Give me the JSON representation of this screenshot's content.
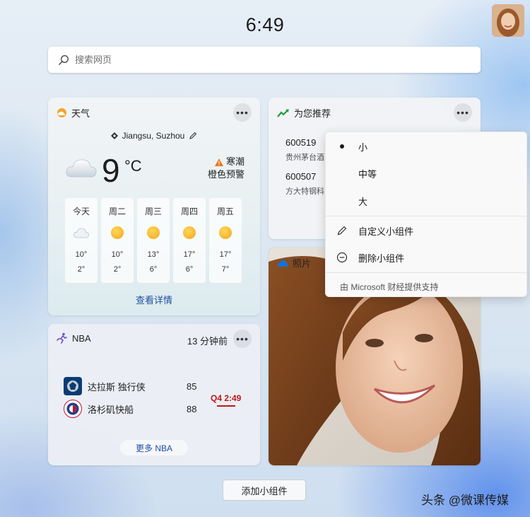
{
  "clock": "6:49",
  "search": {
    "placeholder": "搜索网页"
  },
  "weather": {
    "title": "天气",
    "location": "Jiangsu, Suzhou",
    "temperature": "9",
    "unit": "°C",
    "alert_line1": "寒潮",
    "alert_line2": "橙色预警",
    "days": [
      {
        "label": "今天",
        "icon": "cloud-icon",
        "high": "10°",
        "low": "2°"
      },
      {
        "label": "周二",
        "icon": "sun-icon",
        "high": "10°",
        "low": "2°"
      },
      {
        "label": "周三",
        "icon": "sun-icon",
        "high": "13°",
        "low": "6°"
      },
      {
        "label": "周四",
        "icon": "sun-icon",
        "high": "17°",
        "low": "6°"
      },
      {
        "label": "周五",
        "icon": "sun-icon",
        "high": "17°",
        "low": "7°"
      }
    ],
    "detail_link": "查看详情",
    "accent_color": "#f0a020"
  },
  "nba": {
    "title": "NBA",
    "time_ago": "13 分钟前",
    "teams": [
      {
        "name": "达拉斯 独行侠",
        "score": "85"
      },
      {
        "name": "洛杉矶快船",
        "score": "88"
      }
    ],
    "status": "Q4 2:49",
    "status_color": "#c01818",
    "more_link": "更多 NBA"
  },
  "stocks": {
    "title": "为您推荐",
    "items": [
      {
        "code": "600519",
        "name": "贵州茅台酒"
      },
      {
        "code": "600507",
        "name": "方大特钢科"
      }
    ]
  },
  "photos": {
    "title": "照片"
  },
  "menu": {
    "size_small": "小",
    "size_medium": "中等",
    "size_large": "大",
    "customize": "自定义小组件",
    "remove": "删除小组件",
    "footer": "由 Microsoft 财经提供支持"
  },
  "add_widget": "添加小组件",
  "watermark": "头条 @微课传媒"
}
